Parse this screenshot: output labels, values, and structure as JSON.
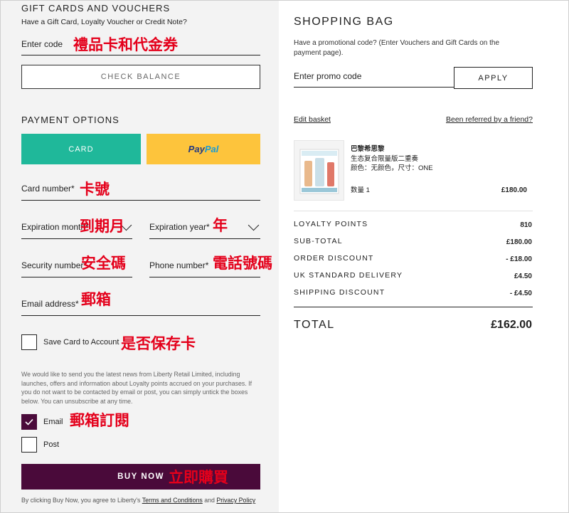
{
  "gift": {
    "heading": "GIFT CARDS AND VOUCHERS",
    "subheading": "Have a Gift Card, Loyalty Voucher or Credit Note?",
    "code_label": "Enter code",
    "check_balance_label": "CHECK BALANCE"
  },
  "payment": {
    "heading": "PAYMENT OPTIONS",
    "card_label": "CARD",
    "paypal_part1": "Pay",
    "paypal_part2": "Pal",
    "card_number_label": "Card number*",
    "expiration_month_label": "Expiration month*",
    "expiration_year_label": "Expiration year*",
    "security_number_label": "Security number*",
    "phone_number_label": "Phone number*",
    "email_label": "Email address*",
    "save_card_label": "Save Card to Account"
  },
  "newsletter": {
    "text": "We would like to send you the latest news from Liberty Retail Limited, including launches, offers and information about Loyalty points accrued on your purchases. If you do not want to be contacted by email or post, you can simply untick the boxes below. You can unsubscribe at any time.",
    "email_label": "Email",
    "email_checked": true,
    "post_label": "Post",
    "post_checked": false
  },
  "buy": {
    "label": "BUY NOW",
    "legal_prefix": "By clicking Buy Now, you agree to Liberty's ",
    "terms_link": "Terms and Conditions",
    "legal_and": " and ",
    "privacy_link": "Privacy Policy"
  },
  "annotations": {
    "gift_code": "禮品卡和代金券",
    "card_number": "卡號",
    "expiry_month": "到期月",
    "expiry_year": "年",
    "security": "安全碼",
    "phone": "電話號碼",
    "email": "郵箱",
    "save_card": "是否保存卡",
    "subscribe": "郵箱訂閱",
    "buy_now": "立即購買"
  },
  "bag": {
    "heading": "SHOPPING BAG",
    "promo_text": "Have a promotional code? (Enter Vouchers and Gift Cards on the payment page).",
    "promo_placeholder": "Enter promo code",
    "apply_label": "APPLY",
    "edit_basket": "Edit basket",
    "referred": "Been referred by a friend?",
    "product": {
      "brand": "巴黎希思黎",
      "name": "生态复合限量版二重奏",
      "variant": "颜色：无颜色，尺寸：ONE",
      "qty": "数量 1",
      "price": "£180.00"
    },
    "summary": [
      {
        "label": "LOYALTY POINTS",
        "value": "810"
      },
      {
        "label": "SUB-TOTAL",
        "value": "£180.00"
      },
      {
        "label": "ORDER DISCOUNT",
        "value": "- £18.00"
      },
      {
        "label": "UK STANDARD DELIVERY",
        "value": "£4.50"
      },
      {
        "label": "SHIPPING DISCOUNT",
        "value": "- £4.50"
      }
    ],
    "total_label": "TOTAL",
    "total_value": "£162.00"
  },
  "colors": {
    "card_button": "#1fb89a",
    "paypal_button": "#fdc43c",
    "buy_button": "#4a0a3a",
    "annotation": "#e4001b"
  }
}
